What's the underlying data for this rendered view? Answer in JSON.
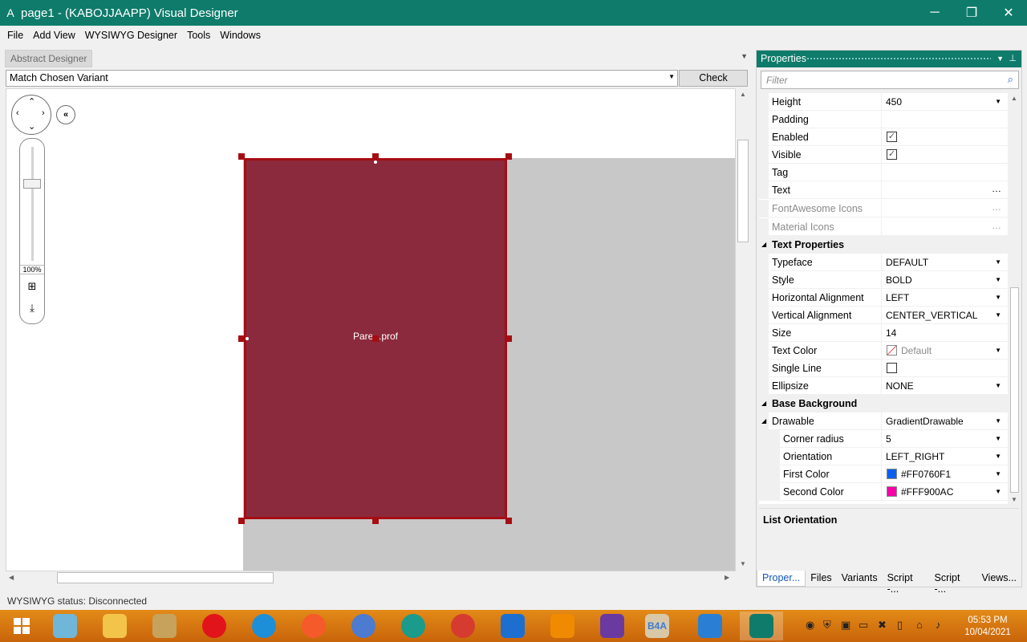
{
  "window": {
    "app_glyph": "A",
    "title": "page1 - (KABOJJAAPP) Visual Designer",
    "minimize": "─",
    "restore": "❐",
    "close": "✕"
  },
  "menu": [
    "File",
    "Add View",
    "WYSIWYG Designer",
    "Tools",
    "Windows"
  ],
  "designer": {
    "tab": "Abstract Designer",
    "variant": "Match Chosen Variant",
    "check_anchors": "Check Anchors",
    "zoom": "100%",
    "panel_label": "Pare...prof",
    "panel_color": "#8b2a3c",
    "selection_color": "#a50d12"
  },
  "properties": {
    "title": "Properties",
    "filter_placeholder": "Filter",
    "rows": {
      "height": {
        "label": "Height",
        "value": "450"
      },
      "padding": {
        "label": "Padding",
        "value": ""
      },
      "enabled": {
        "label": "Enabled",
        "value": "✓"
      },
      "visible": {
        "label": "Visible",
        "value": "✓"
      },
      "tag": {
        "label": "Tag",
        "value": ""
      },
      "text": {
        "label": "Text",
        "value": ""
      },
      "fa_icons": {
        "label": "FontAwesome Icons",
        "value": ""
      },
      "material_icons": {
        "label": "Material Icons",
        "value": ""
      },
      "text_props": {
        "label": "Text Properties"
      },
      "typeface": {
        "label": "Typeface",
        "value": "DEFAULT"
      },
      "style": {
        "label": "Style",
        "value": "BOLD"
      },
      "h_align": {
        "label": "Horizontal Alignment",
        "value": "LEFT"
      },
      "v_align": {
        "label": "Vertical Alignment",
        "value": "CENTER_VERTICAL"
      },
      "size": {
        "label": "Size",
        "value": "14"
      },
      "text_color": {
        "label": "Text Color",
        "value": "Default"
      },
      "single_line": {
        "label": "Single Line",
        "value": ""
      },
      "ellipsize": {
        "label": "Ellipsize",
        "value": "NONE"
      },
      "base_bg": {
        "label": "Base Background"
      },
      "drawable": {
        "label": "Drawable",
        "value": "GradientDrawable"
      },
      "corner_radius": {
        "label": "Corner radius",
        "value": "5"
      },
      "orientation": {
        "label": "Orientation",
        "value": "LEFT_RIGHT"
      },
      "first_color": {
        "label": "First Color",
        "value": "#FF0760F1",
        "swatch": "#0760f1"
      },
      "second_color": {
        "label": "Second Color",
        "value": "#FFF900AC",
        "swatch": "#f900ac"
      }
    },
    "description_title": "List Orientation",
    "tabs": [
      "Proper...",
      "Files",
      "Variants",
      "Script -...",
      "Script -...",
      "Views..."
    ]
  },
  "status": "WYSIWYG status: Disconnected",
  "taskbar": {
    "time": "05:53 PM",
    "date": "10/04/2021",
    "apps": [
      "start-icon",
      "notepad-icon",
      "file-explorer-icon",
      "tools-icon",
      "opera-icon",
      "internet-explorer-icon",
      "firefox-icon",
      "chromium-icon",
      "edge-icon",
      "chrome-icon",
      "mail-icon",
      "vlc-icon",
      "visual-studio-icon",
      "b4a-icon",
      "flame-icon",
      "designer-app-icon"
    ],
    "b4a_label": "B4A"
  }
}
